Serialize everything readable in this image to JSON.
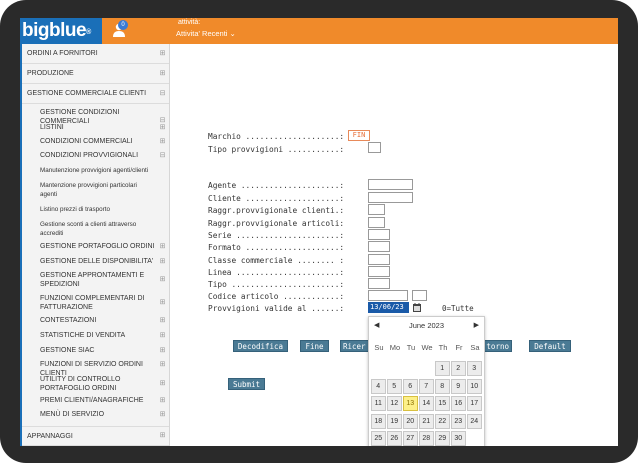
{
  "header": {
    "logo": "bigblue",
    "logo_mark": "®",
    "notification_count": "0",
    "activity_label": "attività:",
    "activity_value": "Attivita' Recenti ⌄"
  },
  "sidebar": {
    "items": [
      {
        "label": "ORDINI A FORNITORI",
        "toggle": "⊞"
      },
      {
        "label": "PRODUZIONE",
        "toggle": "⊞"
      },
      {
        "label": "GESTIONE COMMERCIALE CLIENTI",
        "toggle": "⊟"
      },
      {
        "label": "GESTIONE CONDIZIONI COMMERCIALI",
        "toggle": "⊟"
      },
      {
        "label": "LISTINI",
        "toggle": "⊞"
      },
      {
        "label": "CONDIZIONI COMMERCIALI",
        "toggle": "⊞"
      },
      {
        "label": "CONDIZIONI PROVVIGIONALI",
        "toggle": "⊟"
      },
      {
        "label": "Manutenzione provvigioni agenti/clienti"
      },
      {
        "label": "Mantenzione provvigioni particolari agenti"
      },
      {
        "label": "Listino prezzi di trasporto"
      },
      {
        "label": "Gestione sconti a clienti attraverso accrediti"
      },
      {
        "label": "GESTIONE PORTAFOGLIO ORDINI",
        "toggle": "⊞"
      },
      {
        "label": "GESTIONE DELLE DISPONIBILITA'",
        "toggle": "⊞"
      },
      {
        "label": "GESTIONE APPRONTAMENTI E SPEDIZIONI",
        "toggle": "⊞"
      },
      {
        "label": "FUNZIONI COMPLEMENTARI DI FATTURAZIONE",
        "toggle": "⊞"
      },
      {
        "label": "CONTESTAZIONI",
        "toggle": "⊞"
      },
      {
        "label": "STATISTICHE DI VENDITA",
        "toggle": "⊞"
      },
      {
        "label": "GESTIONE SIAC",
        "toggle": "⊞"
      },
      {
        "label": "FUNZIONI DI SERVIZIO ORDINI CLIENTI",
        "toggle": "⊞"
      },
      {
        "label": "UTILITY DI CONTROLLO PORTAFOGLIO ORDINI",
        "toggle": "⊞"
      },
      {
        "label": "PREMI CLIENTI/ANAGRAFICHE",
        "toggle": "⊞"
      },
      {
        "label": "MENÙ DI SERVIZIO",
        "toggle": "⊞"
      },
      {
        "label": "APPANNAGGI",
        "toggle": "⊞"
      }
    ]
  },
  "form": {
    "marchio_label": "Marchio ....................:",
    "marchio_value": "FIN",
    "tipo_provv_label": "Tipo provvigioni ...........:",
    "agente_label": "Agente .....................:",
    "cliente_label": "Cliente ....................:",
    "raggr_clienti_label": "Raggr.provvigionale clienti.:",
    "raggr_articoli_label": "Raggr.provvigionale articoli:",
    "serie_label": "Serie ......................:",
    "formato_label": "Formato ....................:",
    "classe_label": "Classe commerciale ........ :",
    "linea_label": "Linea ......................:",
    "tipo_label": "Tipo .......................:",
    "codice_label": "Codice articolo ............:",
    "provv_valide_label": "Provvigioni valide al ......:",
    "date_value": "13/06/23",
    "tutte_note": "0=Tutte"
  },
  "buttons": {
    "decodifica": "Decodifica",
    "fine": "Fine",
    "ricerca": "Ricer",
    "ritorno": "torno",
    "default": "Default",
    "submit": "Submit"
  },
  "calendar": {
    "prev": "◀",
    "next": "▶",
    "title": "June 2023",
    "days_of_week": [
      "Su",
      "Mo",
      "Tu",
      "We",
      "Th",
      "Fr",
      "Sa"
    ],
    "weeks": [
      [
        "",
        "",
        "",
        "",
        "1",
        "2",
        "3"
      ],
      [
        "4",
        "5",
        "6",
        "7",
        "8",
        "9",
        "10"
      ],
      [
        "11",
        "12",
        "13",
        "14",
        "15",
        "16",
        "17"
      ],
      [
        "18",
        "19",
        "20",
        "21",
        "22",
        "23",
        "24"
      ],
      [
        "25",
        "26",
        "27",
        "28",
        "29",
        "30",
        ""
      ]
    ],
    "selected_day": "13"
  }
}
